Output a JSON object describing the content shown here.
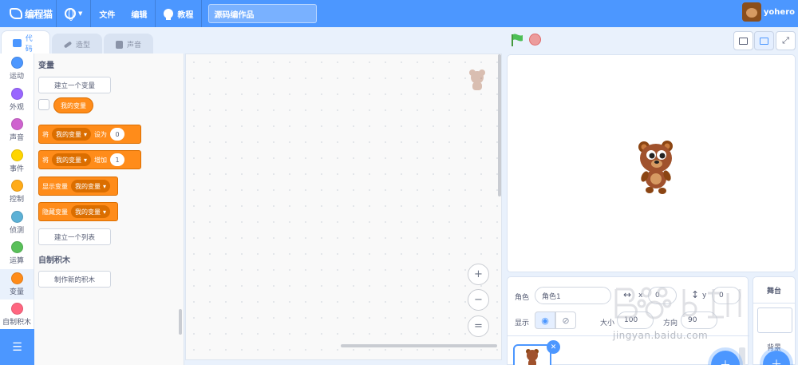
{
  "brand": {
    "logo_text": "编程猫"
  },
  "topbar": {
    "file": "文件",
    "edit": "编辑",
    "tutorial": "教程",
    "project_title": "源码编作品",
    "username": "yohero"
  },
  "tabs": [
    {
      "label": "代码",
      "active": true
    },
    {
      "label": "造型",
      "active": false
    },
    {
      "label": "声音",
      "active": false
    }
  ],
  "categories": [
    {
      "label": "运动",
      "color": "#4c97ff"
    },
    {
      "label": "外观",
      "color": "#9966ff"
    },
    {
      "label": "声音",
      "color": "#cf63cf"
    },
    {
      "label": "事件",
      "color": "#ffd500"
    },
    {
      "label": "控制",
      "color": "#ffab19"
    },
    {
      "label": "侦测",
      "color": "#5cb1d6"
    },
    {
      "label": "运算",
      "color": "#59c059"
    },
    {
      "label": "变量",
      "color": "#ff8c1a"
    },
    {
      "label": "自制积木",
      "color": "#ff6680"
    }
  ],
  "palette": {
    "variables_heading": "变量",
    "make_variable": "建立一个变量",
    "my_variable": "我的变量",
    "set_block": {
      "prefix": "将",
      "var": "我的变量",
      "op": "设为",
      "value": "0"
    },
    "change_block": {
      "prefix": "将",
      "var": "我的变量",
      "op": "增加",
      "value": "1"
    },
    "show_block": {
      "label": "显示变量",
      "var": "我的变量"
    },
    "hide_block": {
      "label": "隐藏变量",
      "var": "我的变量"
    },
    "make_list": "建立一个列表",
    "my_blocks_heading": "自制积木",
    "make_block": "制作新的积木"
  },
  "zoom": {
    "in": "+",
    "out": "−",
    "reset": "="
  },
  "sprite_info": {
    "sprite_label": "角色",
    "sprite_name": "角色1",
    "x_label": "x",
    "x_value": "0",
    "y_label": "y",
    "y_value": "0",
    "show_label": "显示",
    "size_label": "大小",
    "size_value": "100",
    "direction_label": "方向",
    "direction_value": "90"
  },
  "stage_panel": {
    "title": "舞台",
    "backdrop_label": "背景"
  },
  "watermark": {
    "text": "jingyan.baidu.com"
  },
  "colors": {
    "accent": "#4c97ff",
    "variables": "#ff8c1a"
  }
}
